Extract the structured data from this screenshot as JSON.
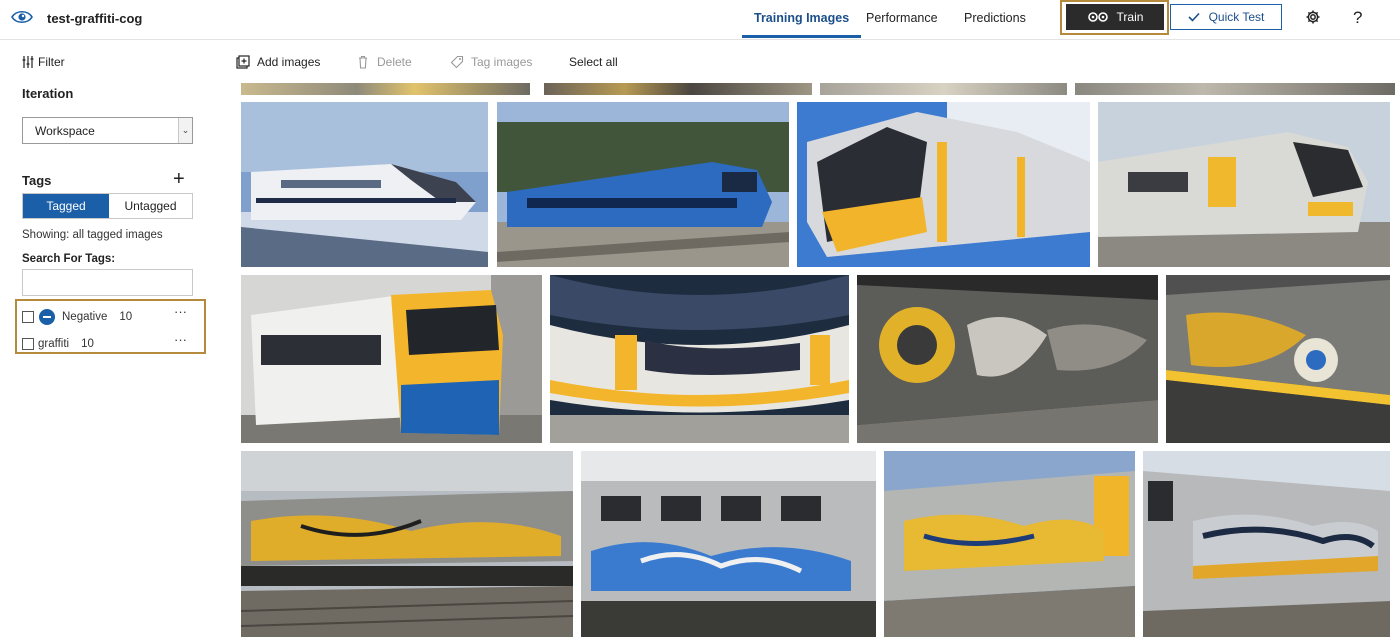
{
  "header": {
    "project_name": "test-graffiti-cog",
    "tabs": [
      {
        "label": "Training Images",
        "active": true
      },
      {
        "label": "Performance",
        "active": false
      },
      {
        "label": "Predictions",
        "active": false
      }
    ],
    "train_label": "Train",
    "quick_test_label": "Quick Test",
    "settings_icon": "gear-icon",
    "help_label": "?",
    "accent_color": "#1b5fa8"
  },
  "sidebar": {
    "filter_label": "Filter",
    "iteration_label": "Iteration",
    "iteration_value": "Workspace",
    "tags_label": "Tags",
    "add_tag_label": "+",
    "toggle": {
      "tagged": "Tagged",
      "untagged": "Untagged"
    },
    "showing_text": "Showing: all tagged images",
    "search_label": "Search For Tags:",
    "search_value": "",
    "tags": [
      {
        "name": "Negative",
        "count": "10",
        "more": "···"
      },
      {
        "name": "graffiti",
        "count": "10",
        "more": "···"
      }
    ]
  },
  "toolbar": {
    "add_images": "Add images",
    "delete": "Delete",
    "tag_images": "Tag images",
    "select_all": "Select all"
  },
  "gallery": {
    "images": [
      {
        "name": "white-highspeed-train-snow",
        "style": "highspeed"
      },
      {
        "name": "blue-regional-train",
        "style": "bluetrain"
      },
      {
        "name": "yellow-silver-train-closeup",
        "style": "yellowsilver"
      },
      {
        "name": "silver-yellow-train-platform",
        "style": "silveryellow2"
      },
      {
        "name": "overground-train-yellow-front",
        "style": "overground"
      },
      {
        "name": "yellow-door-train-fisheye",
        "style": "fisheye"
      },
      {
        "name": "graffiti-train-face-piece",
        "style": "graffitidark"
      },
      {
        "name": "graffiti-train-station-platform",
        "style": "graffitiplatform"
      },
      {
        "name": "graffiti-train-yard-yellow",
        "style": "graffitiyard"
      },
      {
        "name": "graffiti-train-pinko-blue",
        "style": "graffitiblue"
      },
      {
        "name": "graffiti-train-yellow-bag",
        "style": "graffitiyellowcar"
      },
      {
        "name": "graffiti-train-silver-piece",
        "style": "graffitisilver"
      }
    ]
  }
}
